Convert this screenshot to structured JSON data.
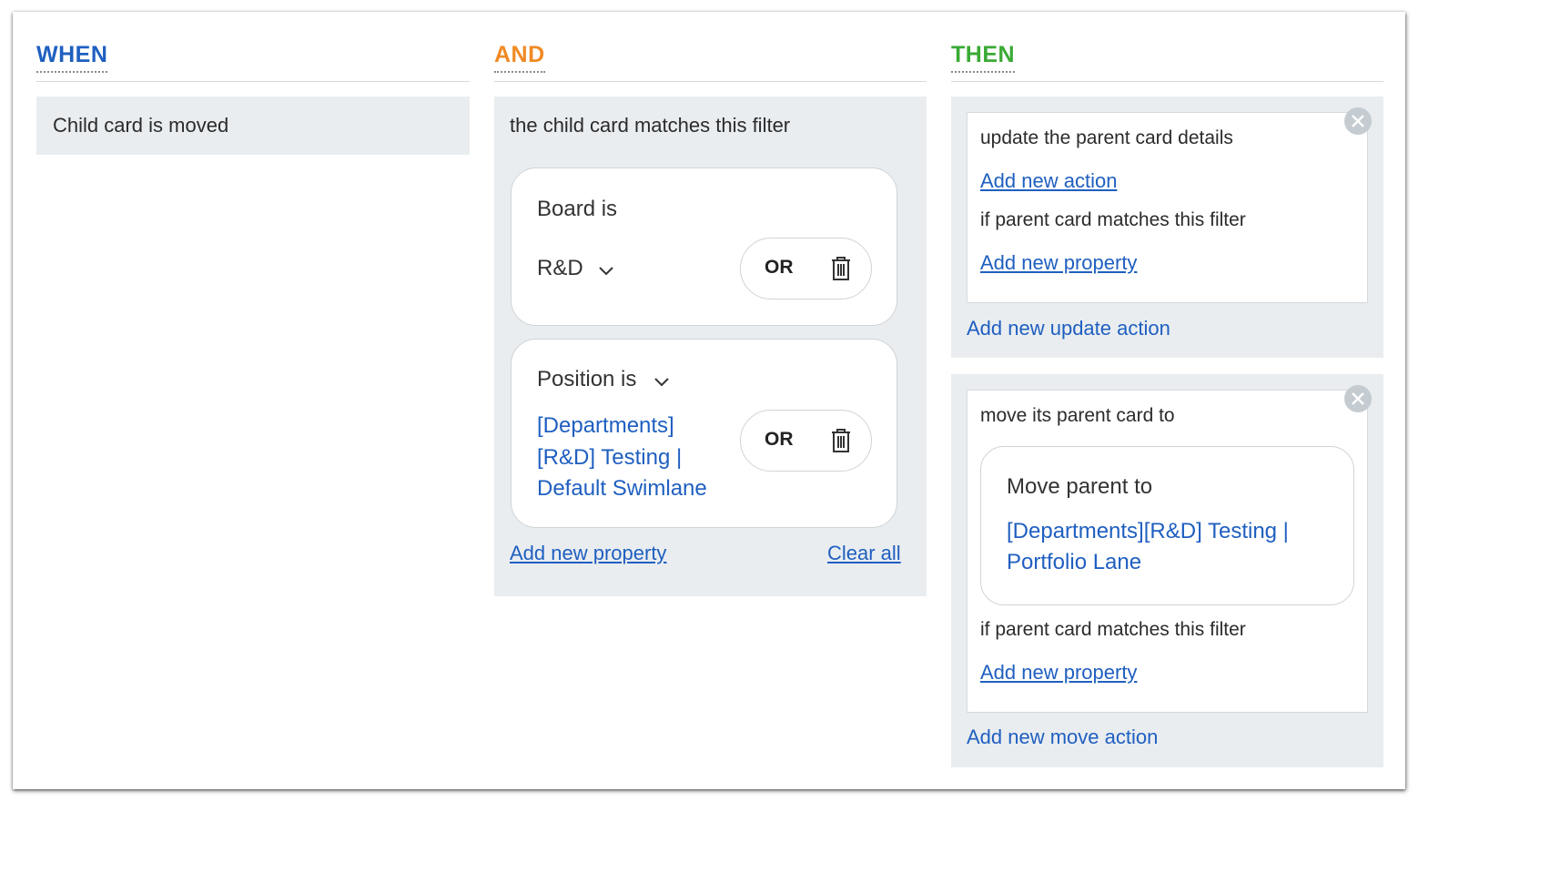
{
  "when": {
    "heading": "WHEN",
    "trigger": "Child card is moved"
  },
  "and": {
    "heading": "AND",
    "title": "the child card matches this filter",
    "filters": [
      {
        "label": "Board is",
        "value": "R&D",
        "or_label": "OR"
      },
      {
        "label": "Position is",
        "value_lines": [
          "[Departments]",
          "[R&D] Testing |",
          "Default Swimlane"
        ],
        "or_label": "OR"
      }
    ],
    "add_property": "Add new property",
    "clear_all": "Clear all"
  },
  "then": {
    "heading": "THEN",
    "update": {
      "title": "update the parent card details",
      "add_action": "Add new action",
      "filter_title": "if parent card matches this filter",
      "add_property": "Add new property",
      "add_update_action": "Add new update action"
    },
    "move": {
      "title": "move its parent card to",
      "card_label": "Move parent to",
      "card_value_lines": [
        "[Departments][R&D] Testing |",
        "Portfolio Lane"
      ],
      "filter_title": "if parent card matches this filter",
      "add_property": "Add new property",
      "add_move_action": "Add new move action"
    }
  },
  "colors": {
    "when": "#1f5fc0",
    "and": "#f08a24",
    "then": "#3aaa35",
    "link": "#1f5fc0",
    "panel": "#e9edf0"
  },
  "icons": [
    "chevron-down-icon",
    "trash-icon",
    "close-icon"
  ]
}
